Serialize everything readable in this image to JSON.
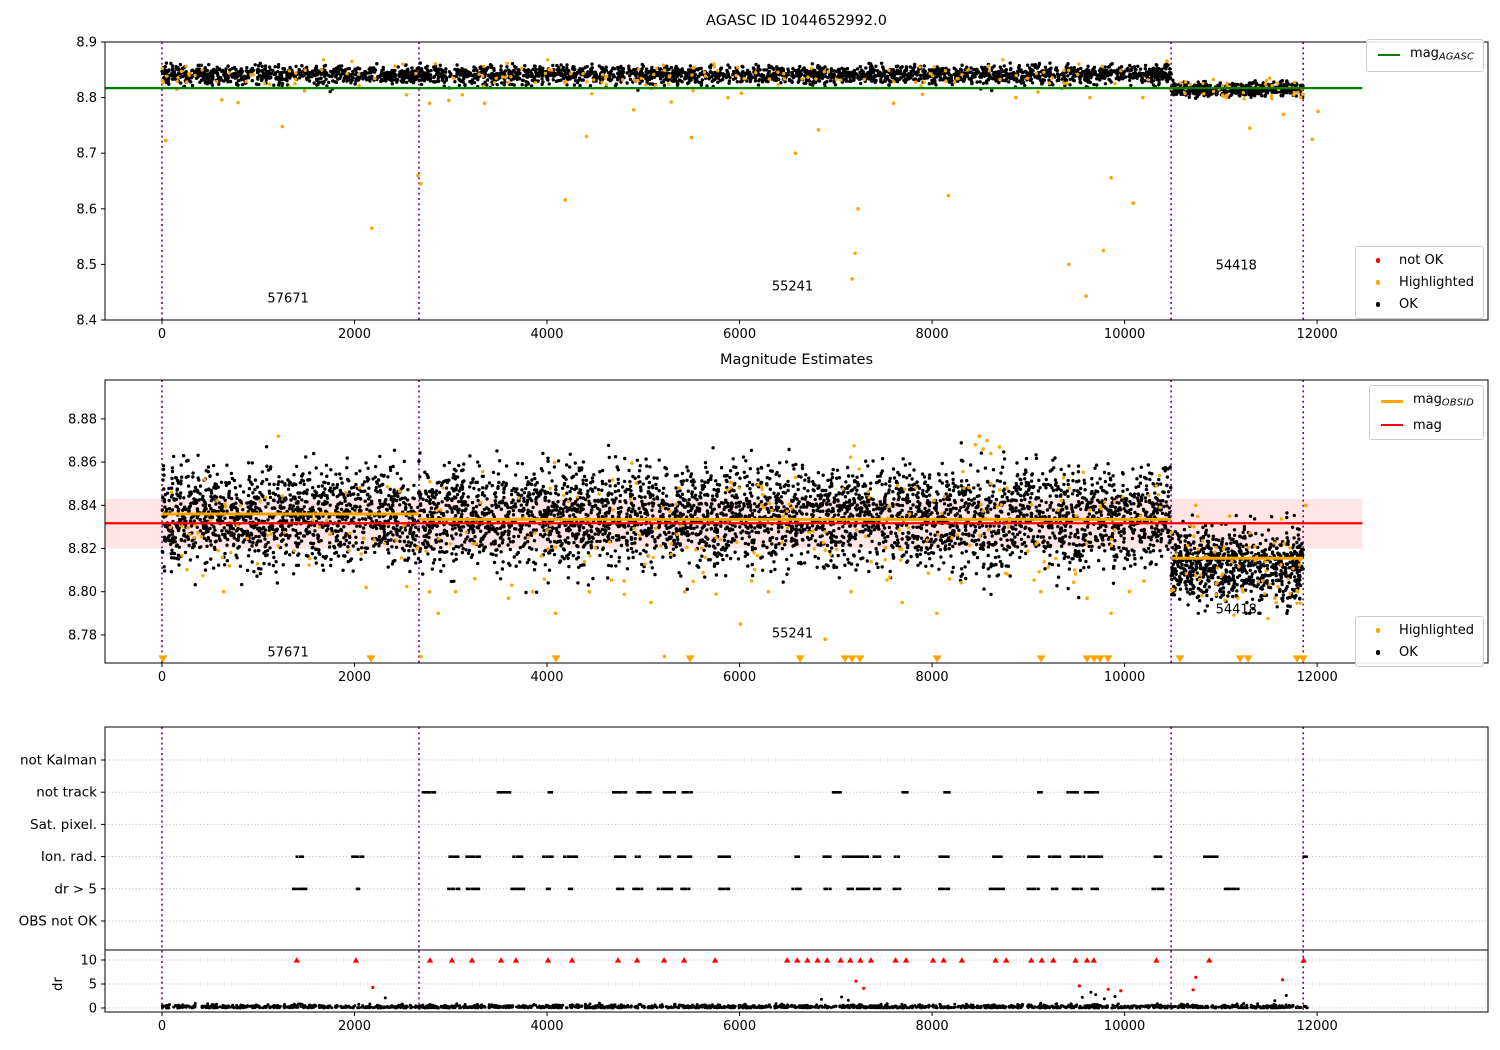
{
  "figure": {
    "background": "#ffffff"
  },
  "colors": {
    "ok": "#000000",
    "highlighted": "#ffa500",
    "not_ok": "#ff0000",
    "mag_agasc_line": "#008000",
    "mag_line": "#ff0000",
    "mag_obsid_line": "#ffa500",
    "mag_err_band": "rgba(255,0,0,0.10)",
    "obsid_vline": "#800080",
    "grid": "#b8b8b8",
    "frame": "#000000"
  },
  "chart_data": [
    {
      "type": "scatter",
      "panel": "top",
      "title": "AGASC ID 1044652992.0",
      "xlim": [
        -592,
        13775
      ],
      "ylim": [
        8.4,
        8.9
      ],
      "xticks": [
        0,
        2000,
        4000,
        6000,
        8000,
        10000,
        12000
      ],
      "yticks": [
        "8.4",
        "8.5",
        "8.6",
        "8.7",
        "8.8",
        "8.9"
      ],
      "mag_agasc": 8.817,
      "hline_x_extent": [
        -592,
        12470
      ],
      "obsid_vlines": [
        0,
        2670,
        10483,
        11855
      ],
      "annotations": [
        {
          "text": "57671",
          "x": 1310,
          "y": 8.437
        },
        {
          "text": "55241",
          "x": 6550,
          "y": 8.459
        },
        {
          "text": "54418",
          "x": 11160,
          "y": 8.498
        }
      ],
      "legend_line": [
        {
          "label": "mag",
          "sub": "AGASC",
          "color": "#008000",
          "weight": 2
        }
      ],
      "legend_markers": [
        {
          "label": "not OK",
          "color": "#ff0000"
        },
        {
          "label": "Highlighted",
          "color": "#ffa500"
        },
        {
          "label": "OK",
          "color": "#000000"
        }
      ],
      "ok_bands": [
        {
          "x0": 0,
          "x1": 10483,
          "center": 8.842,
          "spread": 0.0075,
          "clip": [
            8.822,
            8.862
          ],
          "n": 2800
        },
        {
          "x0": 0,
          "x1": 10483,
          "center": 8.826,
          "spread": 0.006,
          "clip": [
            8.806,
            8.836
          ],
          "n": 130
        },
        {
          "x0": 10483,
          "x1": 11855,
          "center": 8.8155,
          "spread": 0.006,
          "clip": [
            8.799,
            8.832
          ],
          "n": 520
        }
      ],
      "highlighted_band": [
        {
          "x0": 0,
          "x1": 10483,
          "center": 8.84,
          "spread": 0.012,
          "clip": [
            8.79,
            8.868
          ],
          "n": 150
        },
        {
          "x0": 10483,
          "x1": 11855,
          "center": 8.814,
          "spread": 0.01,
          "clip": [
            8.79,
            8.835
          ],
          "n": 40
        }
      ],
      "highlighted_points": [
        [
          40,
          8.723
        ],
        [
          620,
          8.796
        ],
        [
          790,
          8.791
        ],
        [
          1250,
          8.748
        ],
        [
          1480,
          8.812
        ],
        [
          2180,
          8.565
        ],
        [
          2540,
          8.805
        ],
        [
          2660,
          8.66
        ],
        [
          2690,
          8.645
        ],
        [
          2780,
          8.79
        ],
        [
          2980,
          8.795
        ],
        [
          3120,
          8.805
        ],
        [
          3350,
          8.79
        ],
        [
          4190,
          8.616
        ],
        [
          4410,
          8.73
        ],
        [
          4900,
          8.778
        ],
        [
          5290,
          8.792
        ],
        [
          5500,
          8.728
        ],
        [
          5880,
          8.8
        ],
        [
          6020,
          8.808
        ],
        [
          6580,
          8.7
        ],
        [
          6820,
          8.742
        ],
        [
          7170,
          8.474
        ],
        [
          7200,
          8.52
        ],
        [
          7230,
          8.6
        ],
        [
          7600,
          8.79
        ],
        [
          7900,
          8.806
        ],
        [
          8170,
          8.624
        ],
        [
          8870,
          8.8
        ],
        [
          9100,
          8.81
        ],
        [
          9420,
          8.5
        ],
        [
          9600,
          8.443
        ],
        [
          9640,
          8.8
        ],
        [
          9780,
          8.525
        ],
        [
          9860,
          8.656
        ],
        [
          10090,
          8.61
        ],
        [
          10190,
          8.8
        ],
        [
          10440,
          8.866
        ],
        [
          11060,
          8.8
        ],
        [
          11300,
          8.745
        ],
        [
          11650,
          8.77
        ],
        [
          11830,
          8.8
        ],
        [
          11950,
          8.725
        ],
        [
          12010,
          8.775
        ]
      ]
    },
    {
      "type": "scatter",
      "panel": "middle",
      "title": "Magnitude Estimates",
      "xlim": [
        -592,
        13775
      ],
      "ylim": [
        8.767,
        8.898
      ],
      "xticks": [
        0,
        2000,
        4000,
        6000,
        8000,
        10000,
        12000
      ],
      "yticks": [
        "8.78",
        "8.80",
        "8.82",
        "8.84",
        "8.86",
        "8.88"
      ],
      "mag": 8.8317,
      "mag_err_band": [
        8.82,
        8.843
      ],
      "hline_x_extent": [
        -592,
        12470
      ],
      "mag_obsid_segments": [
        {
          "x0": 0,
          "x1": 2670,
          "mag": 8.836
        },
        {
          "x0": 2670,
          "x1": 10483,
          "mag": 8.8335
        },
        {
          "x0": 10483,
          "x1": 11855,
          "mag": 8.8155
        }
      ],
      "obsid_vlines": [
        0,
        2670,
        10483,
        11855
      ],
      "annotations": [
        {
          "text": "57671",
          "x": 1310,
          "y": 8.7715
        },
        {
          "text": "55241",
          "x": 6550,
          "y": 8.7805
        },
        {
          "text": "54418",
          "x": 11160,
          "y": 8.7915
        }
      ],
      "legend_line": [
        {
          "label": "mag",
          "sub": "OBSID",
          "color": "#ffa500",
          "weight": 3
        },
        {
          "label": "mag",
          "sub": "",
          "color": "#ff0000",
          "weight": 2
        }
      ],
      "legend_markers": [
        {
          "label": "Highlighted",
          "color": "#ffa500"
        },
        {
          "label": "OK",
          "color": "#000000"
        }
      ],
      "ok_bands": [
        {
          "x0": 0,
          "x1": 10483,
          "center": 8.8345,
          "spread": 0.0115,
          "clip": [
            8.791,
            8.874
          ],
          "n": 5200
        },
        {
          "x0": 10483,
          "x1": 11855,
          "center": 8.8125,
          "spread": 0.0085,
          "clip": [
            8.79,
            8.84
          ],
          "n": 820
        }
      ],
      "highlighted_band": [
        {
          "x0": 0,
          "x1": 10483,
          "center": 8.832,
          "spread": 0.014,
          "clip": [
            8.772,
            8.872
          ],
          "n": 260
        },
        {
          "x0": 10483,
          "x1": 11855,
          "center": 8.812,
          "spread": 0.012,
          "clip": [
            8.772,
            8.845
          ],
          "n": 60
        }
      ],
      "highlighted_points": [
        [
          640,
          8.8
        ],
        [
          700,
          8.812
        ],
        [
          2120,
          8.802
        ],
        [
          2690,
          8.77
        ],
        [
          2780,
          8.8
        ],
        [
          2870,
          8.79
        ],
        [
          3050,
          8.8
        ],
        [
          3250,
          8.806
        ],
        [
          3600,
          8.797
        ],
        [
          3850,
          8.8
        ],
        [
          4090,
          8.79
        ],
        [
          4440,
          8.8
        ],
        [
          4800,
          8.805
        ],
        [
          5080,
          8.795
        ],
        [
          5220,
          8.77
        ],
        [
          5430,
          8.8
        ],
        [
          6010,
          8.785
        ],
        [
          6300,
          8.8
        ],
        [
          6890,
          8.778
        ],
        [
          7160,
          8.8
        ],
        [
          7690,
          8.795
        ],
        [
          8050,
          8.79
        ],
        [
          8450,
          8.868
        ],
        [
          8490,
          8.872
        ],
        [
          8530,
          8.866
        ],
        [
          8570,
          8.87
        ],
        [
          8610,
          8.864
        ],
        [
          8700,
          8.867
        ],
        [
          9130,
          8.8
        ],
        [
          9480,
          8.81
        ],
        [
          9610,
          8.797
        ],
        [
          9860,
          8.79
        ],
        [
          10050,
          8.8
        ],
        [
          10200,
          8.805
        ],
        [
          10740,
          8.84
        ],
        [
          11090,
          8.835
        ],
        [
          11230,
          8.8
        ],
        [
          11560,
          8.797
        ],
        [
          11800,
          8.8
        ],
        [
          11880,
          8.84
        ]
      ],
      "clip_triangles_x": [
        10,
        2171,
        4094,
        5486,
        6629,
        7096,
        7169,
        7252,
        8052,
        9133,
        9610,
        9683,
        9745,
        9828,
        10576,
        11200,
        11283,
        11792,
        11855
      ]
    },
    {
      "type": "flags",
      "panel": "bottom",
      "xlim": [
        -592,
        13775
      ],
      "xticks": [
        0,
        2000,
        4000,
        6000,
        8000,
        10000,
        12000
      ],
      "obsid_vlines": [
        0,
        2670,
        10483,
        11855
      ],
      "flag_rows": [
        "not Kalman",
        "not track",
        "Sat. pixel.",
        "Ion. rad.",
        "dr > 5",
        "OBS not OK"
      ],
      "flag_clusters": {
        "not Kalman": [],
        "not track": [
          2764,
          3543,
          4031,
          4748,
          4997,
          5257,
          5444,
          7002,
          7709,
          8145,
          9111,
          9454,
          9641
        ],
        "Sat. pixel.": [],
        "Ion. rad.": [
          1423,
          2026,
          3023,
          3221,
          3688,
          4000,
          4239,
          4748,
          4935,
          5216,
          5424,
          5829,
          6587,
          6899,
          7138,
          7273,
          7418,
          7626,
          8114,
          8665,
          9039,
          9267,
          9496,
          9683,
          10338,
          10888,
          11864
        ],
        "dr > 5": [
          1423,
          2026,
          3023,
          3221,
          3688,
          4000,
          4239,
          4748,
          4935,
          5216,
          5424,
          5829,
          6587,
          6899,
          7138,
          7273,
          7418,
          7626,
          8114,
          8665,
          9039,
          9267,
          9496,
          9683,
          10338,
          11100
        ],
        "OBS not OK": []
      },
      "dr_axis": {
        "ylabel": "dr",
        "yticks": [
          0,
          5,
          10
        ],
        "clip_value": 10,
        "triangles_x": [
          1400,
          2015,
          2784,
          3013,
          3221,
          3522,
          3678,
          4011,
          4260,
          4738,
          4935,
          5216,
          5424,
          5746,
          6494,
          6600,
          6705,
          6810,
          6910,
          7050,
          7150,
          7255,
          7365,
          7620,
          7730,
          8010,
          8120,
          8310,
          8660,
          8770,
          9030,
          9140,
          9260,
          9490,
          9610,
          9680,
          10330,
          10880,
          11860
        ],
        "red_points": [
          [
            2190,
            4.3
          ],
          [
            7210,
            5.6
          ],
          [
            7290,
            4.1
          ],
          [
            9530,
            4.6
          ],
          [
            9830,
            3.9
          ],
          [
            9960,
            3.6
          ],
          [
            10712,
            3.8
          ],
          [
            10740,
            6.4
          ],
          [
            11640,
            5.9
          ]
        ],
        "black_outliers": [
          [
            2320,
            2.1
          ],
          [
            6850,
            1.8
          ],
          [
            7060,
            2.3
          ],
          [
            7130,
            1.6
          ],
          [
            9560,
            2.2
          ],
          [
            9650,
            3.3
          ],
          [
            9700,
            2.8
          ],
          [
            9790,
            1.9
          ],
          [
            9900,
            2.4
          ],
          [
            11560,
            1.5
          ],
          [
            11680,
            2.6
          ]
        ],
        "ok_band": {
          "x0": 0,
          "x1": 11900,
          "n": 1700,
          "max": 1.3
        }
      }
    }
  ]
}
